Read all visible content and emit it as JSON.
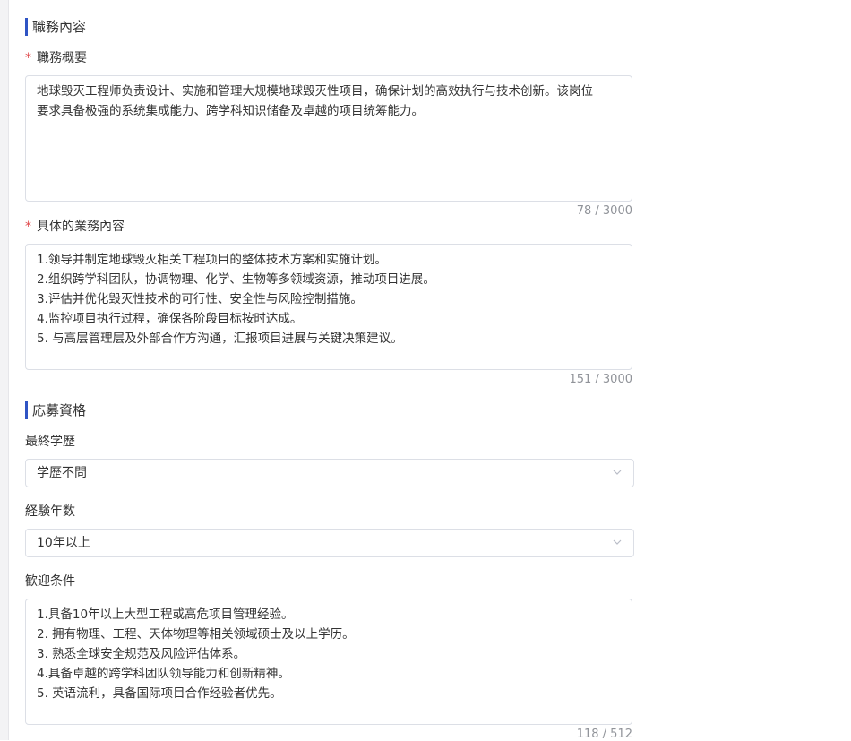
{
  "job_content": {
    "section_title": "職務內容",
    "summary": {
      "label": "職務概要",
      "required_mark": "*",
      "lines": [
        "地球毁灭工程师负责设计、实施和管理大规模地球毁灭性项目，确保计划的高效执行与技术创新。该岗位",
        "要求具备极强的系统集成能力、跨学科知识储备及卓越的项目统筹能力。"
      ],
      "counter": "78 / 3000"
    },
    "duties": {
      "label": "具体的業務內容",
      "required_mark": "*",
      "lines": [
        "1.领导并制定地球毁灭相关工程项目的整体技术方案和实施计划。",
        "2.组织跨学科团队，协调物理、化学、生物等多领域资源，推动项目进展。",
        "3.评估并优化毁灭性技术的可行性、安全性与风险控制措施。",
        "4.监控项目执行过程，确保各阶段目标按时达成。",
        "5. 与高层管理层及外部合作方沟通，汇报项目进展与关键决策建议。"
      ],
      "counter": "151 / 3000"
    }
  },
  "requirements": {
    "section_title": "応募資格",
    "education": {
      "label": "最終学歷",
      "value": "学歷不問"
    },
    "experience": {
      "label": "経験年数",
      "value": "10年以上"
    },
    "welcome": {
      "label": "歓迎条件",
      "lines": [
        "1.具备10年以上大型工程或高危项目管理经验。",
        "2. 拥有物理、工程、天体物理等相关领域硕士及以上学历。",
        "3. 熟悉全球安全规范及风险评估体系。",
        "4.具备卓越的跨学科团队领导能力和创新精神。",
        "5. 英语流利，具备国际项目合作经验者优先。"
      ],
      "counter": "118 / 512"
    }
  },
  "icons": {
    "select_arrow": "chevron-down-icon"
  },
  "colors": {
    "accent": "#2f54c4",
    "required": "#e0474a",
    "border": "#dcdfe6",
    "counter": "#909399"
  }
}
